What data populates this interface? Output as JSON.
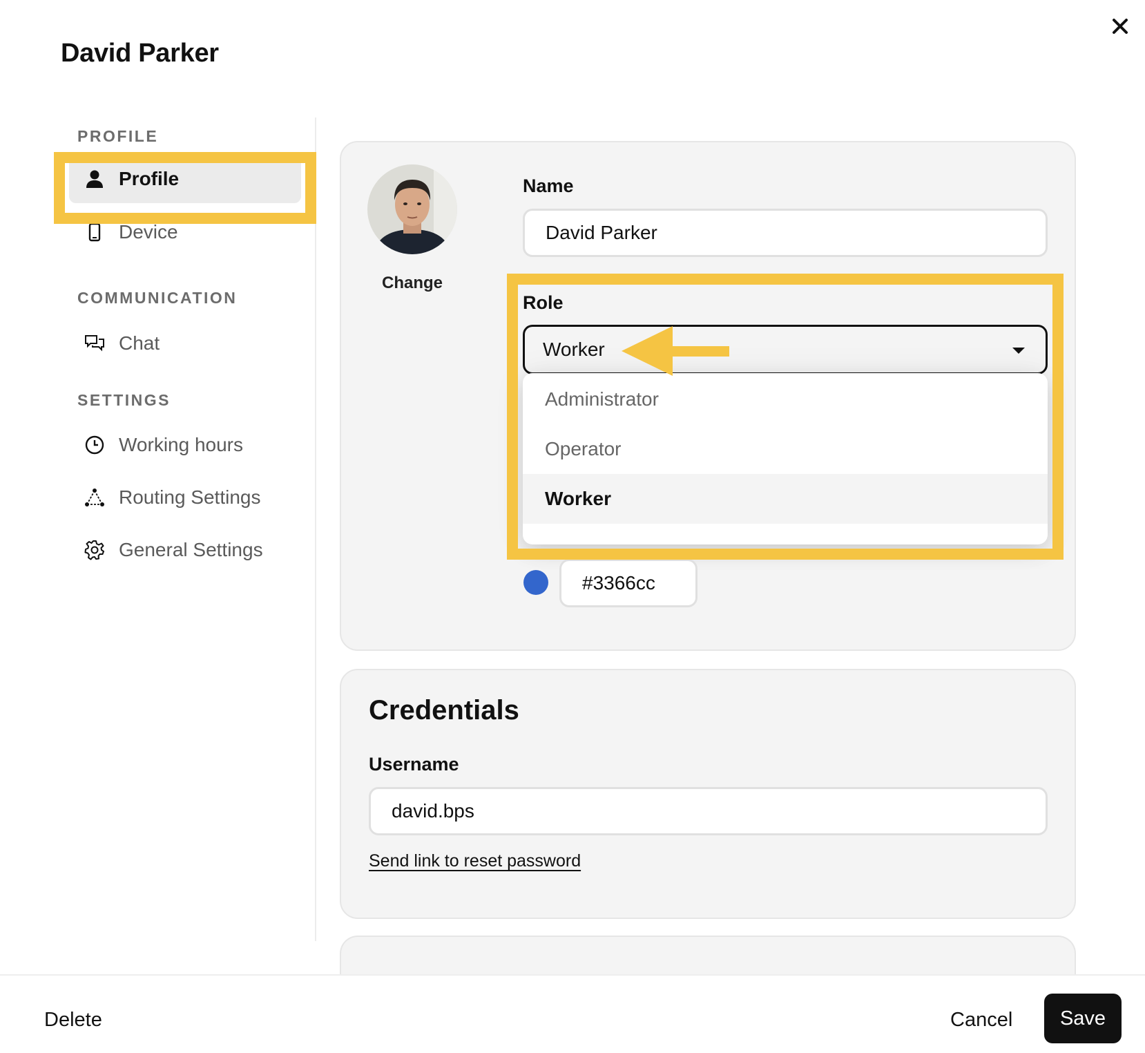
{
  "header": {
    "title": "David Parker"
  },
  "sidebar": {
    "sections": [
      {
        "label": "PROFILE",
        "items": [
          {
            "label": "Profile",
            "icon": "person-icon"
          },
          {
            "label": "Device",
            "icon": "phone-icon"
          }
        ]
      },
      {
        "label": "COMMUNICATION",
        "items": [
          {
            "label": "Chat",
            "icon": "chat-icon"
          }
        ]
      },
      {
        "label": "SETTINGS",
        "items": [
          {
            "label": "Working hours",
            "icon": "clock-icon"
          },
          {
            "label": "Routing Settings",
            "icon": "routing-icon"
          },
          {
            "label": "General Settings",
            "icon": "gear-icon"
          }
        ]
      }
    ],
    "active_item": "Profile"
  },
  "profile": {
    "avatar_action": "Change",
    "name_label": "Name",
    "name_value": "David Parker",
    "role_label": "Role",
    "role_value": "Worker",
    "role_options": [
      "Administrator",
      "Operator",
      "Worker"
    ],
    "color_value": "#3366cc"
  },
  "credentials": {
    "title": "Credentials",
    "username_label": "Username",
    "username_value": "david.bps",
    "reset_link": "Send link to reset password"
  },
  "footer": {
    "delete_label": "Delete",
    "cancel_label": "Cancel",
    "save_label": "Save"
  },
  "colors": {
    "highlight": "#f5c443",
    "agent_color": "#3366cc",
    "primary_button": "#111111"
  }
}
